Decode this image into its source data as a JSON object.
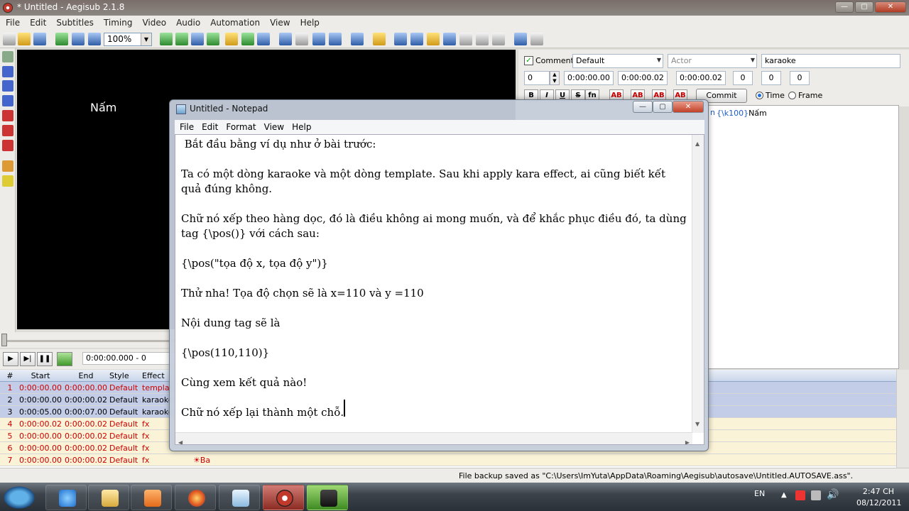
{
  "window": {
    "title": "* Untitled - Aegisub 2.1.8"
  },
  "menu": [
    "File",
    "Edit",
    "Subtitles",
    "Timing",
    "Video",
    "Audio",
    "Automation",
    "View",
    "Help"
  ],
  "toolbar": {
    "zoom": "100%"
  },
  "video": {
    "overlay_text": "Nấm",
    "time": "0:00:00.000 - 0"
  },
  "edit": {
    "comment_label": "Comment",
    "style": "Default",
    "actor_placeholder": "Actor",
    "effect": "karaoke",
    "layer": "0",
    "start": "0:00:00.00",
    "end": "0:00:00.02",
    "duration": "0:00:00.02",
    "margin_l": "0",
    "margin_r": "0",
    "margin_v": "0",
    "format_buttons": [
      "B",
      "I",
      "U",
      "S",
      "fn",
      "AB",
      "AB",
      "AB",
      "AB"
    ],
    "commit": "Commit",
    "time_label": "Time",
    "frame_label": "Frame",
    "text_prefix": "{\\k100}",
    "text_body": "Nấm",
    "text_left_fragment": "n"
  },
  "grid": {
    "headers": [
      "#",
      "Start",
      "End",
      "Style",
      "Effect"
    ],
    "rows": [
      {
        "n": "1",
        "start": "0:00:00.00",
        "end": "0:00:00.00",
        "style": "Default",
        "effect": "templat",
        "text": ""
      },
      {
        "n": "2",
        "start": "0:00:00.00",
        "end": "0:00:00.02",
        "style": "Default",
        "effect": "karaoke",
        "text": ""
      },
      {
        "n": "3",
        "start": "0:00:05.00",
        "end": "0:00:07.00",
        "style": "Default",
        "effect": "karaoke",
        "text": ""
      },
      {
        "n": "4",
        "start": "0:00:00.02",
        "end": "0:00:00.02",
        "style": "Default",
        "effect": "fx",
        "text": ""
      },
      {
        "n": "5",
        "start": "0:00:00.00",
        "end": "0:00:00.02",
        "style": "Default",
        "effect": "fx",
        "text": ""
      },
      {
        "n": "6",
        "start": "0:00:00.00",
        "end": "0:00:00.02",
        "style": "Default",
        "effect": "fx",
        "text": ""
      },
      {
        "n": "7",
        "start": "0:00:00.00",
        "end": "0:00:00.02",
        "style": "Default",
        "effect": "fx",
        "text": "☀Ba"
      }
    ]
  },
  "status": "File backup saved as \"C:\\Users\\ImYuta\\AppData\\Roaming\\Aegisub\\autosave\\Untitled.AUTOSAVE.ass\".",
  "notepad": {
    "title": "Untitled - Notepad",
    "menu": [
      "File",
      "Edit",
      "Format",
      "View",
      "Help"
    ],
    "lines": [
      " Bắt đầu bằng ví dụ như ở bài trước:",
      "Ta có một dòng karaoke và một dòng template. Sau khi apply kara effect, ai cũng biết kết quả đúng không.",
      "Chữ nó xếp theo hàng dọc, đó là điều không ai mong muốn, và để khắc phục điều đó, ta dùng tag {\\pos()} với cách sau:",
      "{\\pos(\"tọa độ x, tọa độ y\")}",
      "Thử nha! Tọa độ chọn sẽ là x=110 và y =110",
      "Nội dung tag sẽ là",
      "{\\pos(110,110)}",
      "Cùng xem kết quả nào!",
      "Chữ nó xếp lại thành một chỗ. "
    ]
  },
  "tray": {
    "lang": "EN",
    "time": "2:47 CH",
    "date": "08/12/2011"
  }
}
